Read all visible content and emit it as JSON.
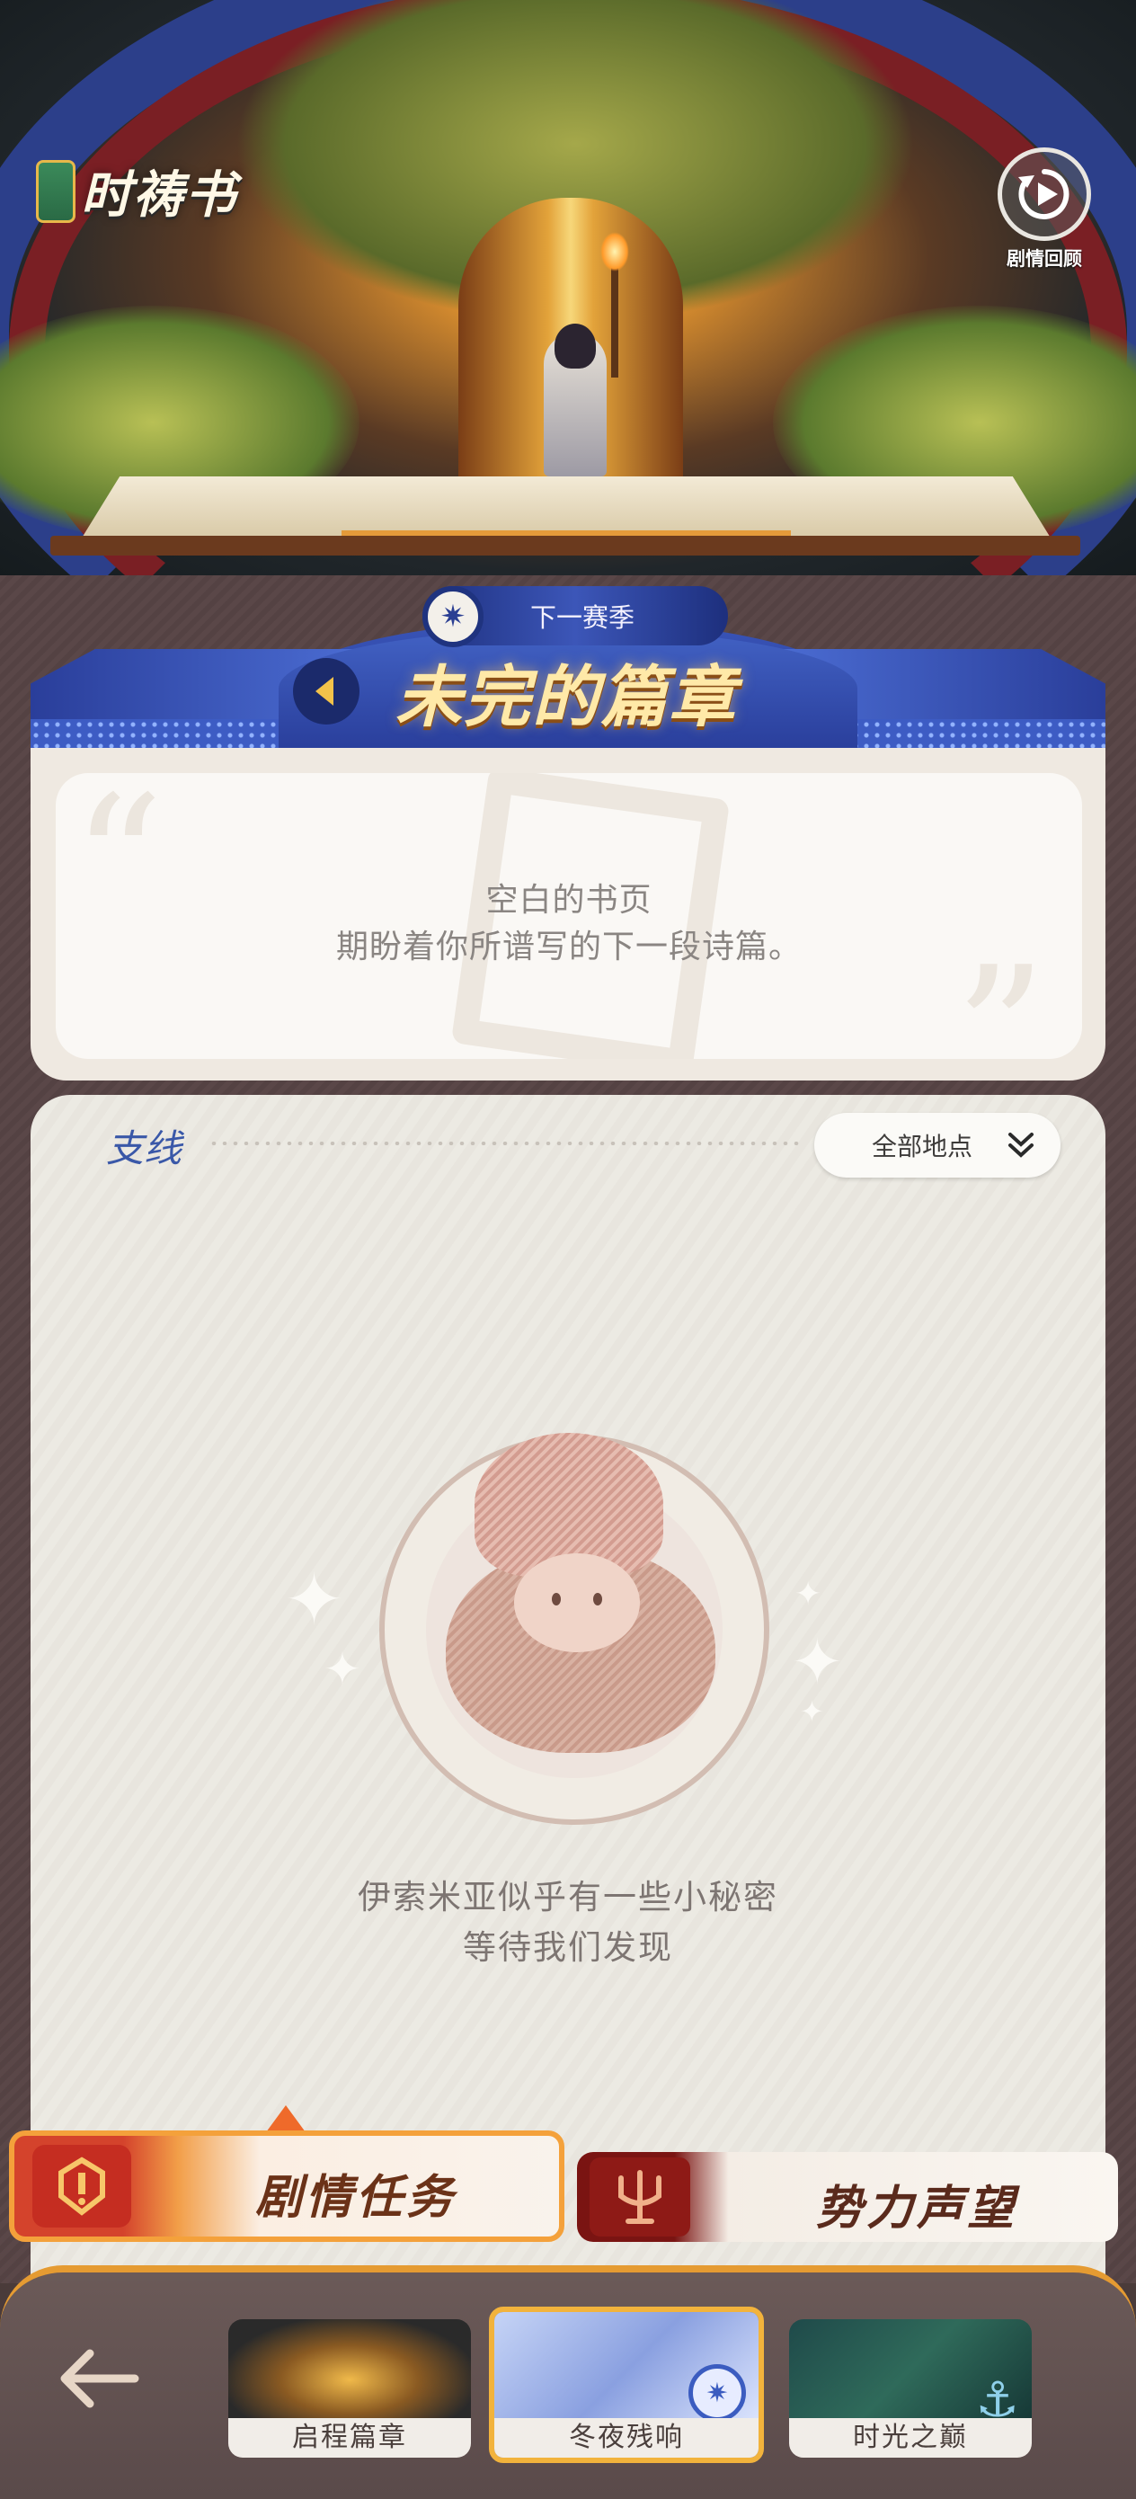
{
  "hero": {
    "logo_text": "时祷书",
    "replay_label": "剧情回顾"
  },
  "season": {
    "pill_label": "下一赛季",
    "banner_title": "未完的篇章"
  },
  "quote": {
    "line1": "空白的书页",
    "line2": "期盼着你所谱写的下一段诗篇。",
    "open_mark": "“",
    "close_mark": "”"
  },
  "side_quests": {
    "title": "支线",
    "filter_label": "全部地点",
    "empty_line1": "伊索米亚似乎有一些小秘密",
    "empty_line2": "等待我们发现"
  },
  "tabs": [
    {
      "label": "剧情任务",
      "active": true
    },
    {
      "label": "势力声望",
      "active": false
    }
  ],
  "chapters": [
    {
      "label": "启程篇章",
      "active": false
    },
    {
      "label": "冬夜残响",
      "active": true
    },
    {
      "label": "时光之巅",
      "active": false
    }
  ],
  "colors": {
    "banner_blue": "#3d5cc4",
    "accent_orange": "#f2b33c",
    "story_red": "#c52d21",
    "faction_red": "#8e1a16"
  }
}
